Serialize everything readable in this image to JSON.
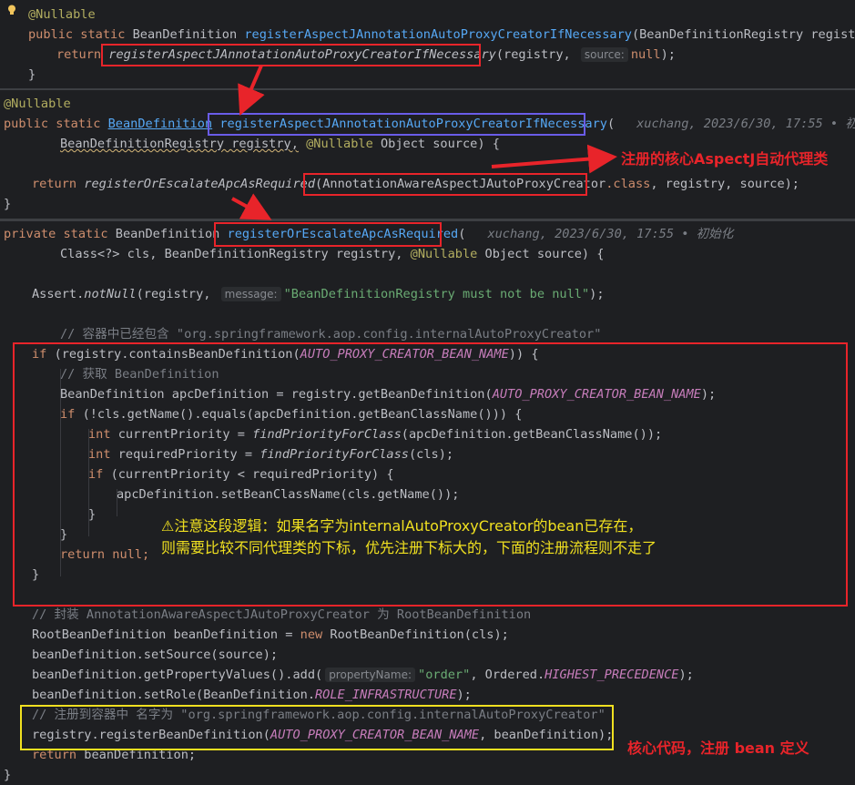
{
  "colors": {
    "editor_bg": "#1e1f22",
    "keyword": "#cf8e6d",
    "method_decl": "#56a8f5",
    "string": "#6aab73",
    "annotation": "#b3ae60",
    "comment": "#7a7e85",
    "constant": "#c77dbb",
    "red_annotation": "#e8242a",
    "yellow_annotation": "#f0e020",
    "box_red": "#e8242a",
    "box_blue": "#6a5ce8",
    "box_yellow": "#f0e020"
  },
  "pane1": {
    "annotation": "@Nullable",
    "l2_mod": "public static",
    "l2_type": "BeanDefinition",
    "l2_name": "registerAspectJAnnotationAutoProxyCreatorIfNecessary",
    "l2_params": "(BeanDefinitionRegistry registry) {",
    "l3_return": "return",
    "l3_call": "registerAspectJAnnotationAutoProxyCreatorIfNecessary",
    "l3_args_a": "(registry,",
    "l3_hint": "source:",
    "l3_null": "null",
    "l3_end": ");",
    "l4": "}"
  },
  "pane2": {
    "annotation": "@Nullable",
    "l2_mod": "public static",
    "l2_type": "BeanDefinition",
    "l2_name": "registerAspectJAnnotationAutoProxyCreatorIfNecessary",
    "l2_paren": "(",
    "blame": "xuchang, 2023/6/30, 17:55 • 初始化",
    "l3_a": "BeanDefinitionRegistry registry,",
    "l3_ann": "@Nullable",
    "l3_b": "Object source) {",
    "l5_return": "return",
    "l5_call": "registerOrEscalateApcAsRequired",
    "l5_arg": "(AnnotationAwareAspectJAutoProxyCreator",
    "l5_class": ".class",
    "l5_end": ", registry, source);",
    "l6": "}",
    "note": "注册的核心AspectJ自动代理类"
  },
  "pane3": {
    "l1_mod": "private static",
    "l1_type": "BeanDefinition",
    "l1_name": "registerOrEscalateApcAsRequired",
    "l1_paren": "(",
    "blame": "xuchang, 2023/6/30, 17:55 • 初始化",
    "l2_a": "Class<?> cls, BeanDefinitionRegistry registry,",
    "l2_ann": "@Nullable",
    "l2_b": "Object source) {",
    "assert_a": "Assert.",
    "assert_fn": "notNull",
    "assert_b": "(registry,",
    "assert_hint": "message:",
    "assert_str": "\"BeanDefinitionRegistry must not be null\"",
    "assert_end": ");",
    "c1": "// 容器中已经包含 \"org.springframework.aop.config.internalAutoProxyCreator\"",
    "if1_kw": "if",
    "if1_a": "(registry.containsBeanDefinition(",
    "const_name": "AUTO_PROXY_CREATOR_BEAN_NAME",
    "if1_b": ")) {",
    "c2": "// 获取 BeanDefinition",
    "apc_a": "BeanDefinition apcDefinition = registry.getBeanDefinition(",
    "apc_b": ");",
    "if2_kw": "if",
    "if2_a": "(!cls.getName().equals(apcDefinition.getBeanClassName())) {",
    "int_kw": "int",
    "cur_a": "currentPriority =",
    "find_fn": "findPriorityForClass",
    "cur_b": "(apcDefinition.getBeanClassName());",
    "req_a": "requiredPriority =",
    "req_b": "(cls);",
    "if3_kw": "if",
    "if3_a": "(currentPriority < requiredPriority) {",
    "set_line": "apcDefinition.setBeanClassName(cls.getName());",
    "close": "}",
    "ret_kw": "return",
    "ret_null": "null;",
    "c3": "// 封装 AnnotationAwareAspectJAutoProxyCreator 为 RootBeanDefinition",
    "rbd_a": "RootBeanDefinition beanDefinition =",
    "rbd_new": "new",
    "rbd_b": "RootBeanDefinition(cls);",
    "src_line": "beanDefinition.setSource(source);",
    "pv_a": "beanDefinition.getPropertyValues().add(",
    "pv_hint": "propertyName:",
    "pv_str": "\"order\"",
    "pv_b": ", Ordered.",
    "pv_const": "HIGHEST_PRECEDENCE",
    "pv_end": ");",
    "role_a": "beanDefinition.setRole(BeanDefinition.",
    "role_const": "ROLE_INFRASTRUCTURE",
    "role_end": ");",
    "c4": "// 注册到容器中 名字为 \"org.springframework.aop.config.internalAutoProxyCreator\"",
    "reg_a": "registry.registerBeanDefinition(",
    "reg_b": ", beanDefinition);",
    "ret2_kw": "return",
    "ret2_b": "beanDefinition;",
    "end": "}",
    "warn_line1": "⚠注意这段逻辑：如果名字为internalAutoProxyCreator的bean已存在，",
    "warn_line2": "则需要比较不同代理类的下标，优先注册下标大的，下面的注册流程则不走了",
    "core_note": "核心代码，注册 bean 定义"
  }
}
